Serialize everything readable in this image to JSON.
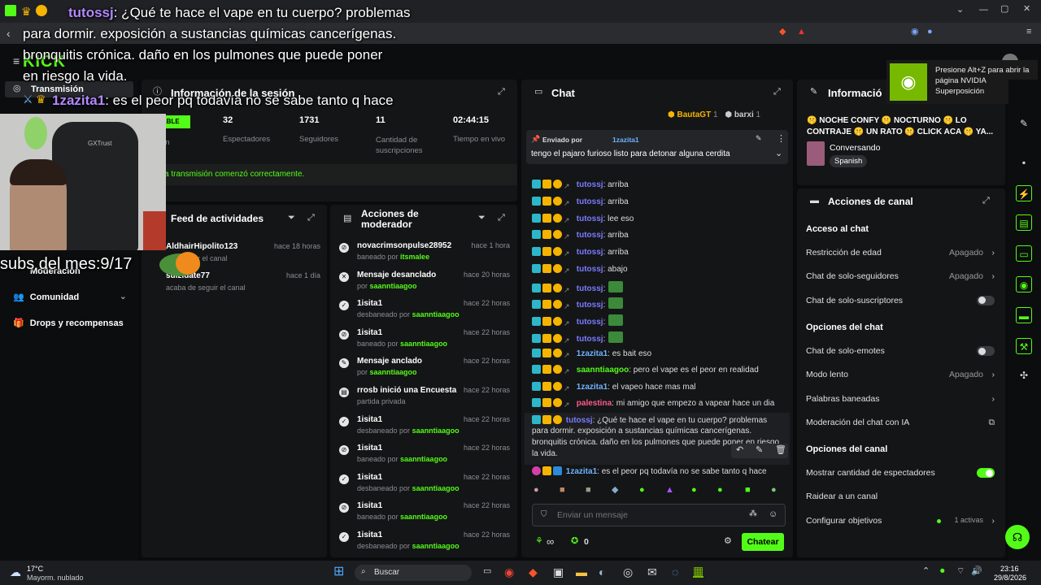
{
  "overlay": {
    "title_user": "tutossj",
    "title_line1": ": ¿Qué te hace el vape en tu cuerpo? problemas",
    "title_line2": "para dormir. exposición a sustancias químicas cancerígenas.",
    "title_line3": "bronquitis crónica. daño en los pulmones que puede poner",
    "title_line4": "en riesgo la vida.",
    "second_user": "1zazita1",
    "second_msg": ": es el peor pq todavía no se sabe tanto q hace",
    "subs_text": "subs del mes:9/17",
    "webcam_brand": "GXTrust"
  },
  "browser": {
    "tab_label": "Transmisión"
  },
  "nvidia": {
    "text": "Presione Alt+Z para abrir la página NVIDIA Superposición"
  },
  "session": {
    "title": "Información de la sesión",
    "badge": "UDABLE",
    "badge_sub": "ón",
    "stats": [
      {
        "value": "32",
        "label": "Espectadores"
      },
      {
        "value": "1731",
        "label": "Seguidores"
      },
      {
        "value": "11",
        "label": "Cantidad de suscripciones"
      },
      {
        "value": "02:44:15",
        "label": "Tiempo en vivo"
      }
    ],
    "status": "a transmisión comenzó correctamente."
  },
  "sidebar": {
    "items": [
      {
        "label": "Moderación"
      },
      {
        "label": "Comunidad"
      },
      {
        "label": "Drops y recompensas"
      }
    ]
  },
  "feed": {
    "title": "Feed de actividades",
    "items": [
      {
        "user": "AldhairHipolito123",
        "action": "eguir el canal",
        "time": "hace 18 horas"
      },
      {
        "user": "suizidate77",
        "action": "acaba de seguir el canal",
        "time": "hace 1 día"
      }
    ]
  },
  "modactions": {
    "title_line1": "Acciones de",
    "title_line2": "moderador",
    "items": [
      {
        "t": "novacrimsonpulse28952",
        "pre": "baneado por ",
        "by": "itsmalee",
        "time": "hace 1 hora",
        "icon": "⊘"
      },
      {
        "t": "Mensaje desanclado",
        "pre": "por ",
        "by": "saanntiaagoo",
        "time": "hace 20 horas",
        "icon": "✕"
      },
      {
        "t": "1isita1",
        "pre": "desbaneado por ",
        "by": "saanntiaagoo",
        "time": "hace 22 horas",
        "icon": "✓"
      },
      {
        "t": "1isita1",
        "pre": "baneado por ",
        "by": "saanntiaagoo",
        "time": "hace 22 horas",
        "icon": "⊘"
      },
      {
        "t": "Mensaje anclado",
        "pre": "por ",
        "by": "saanntiaagoo",
        "time": "hace 22 horas",
        "icon": "✎"
      },
      {
        "t": "rrosb inició una Encuesta",
        "pre": "partida privada",
        "by": "",
        "time": "hace 22 horas",
        "icon": "▤"
      },
      {
        "t": "1isita1",
        "pre": "desbaneado por ",
        "by": "saanntiaagoo",
        "time": "hace 22 horas",
        "icon": "✓"
      },
      {
        "t": "1isita1",
        "pre": "baneado por ",
        "by": "saanntiaagoo",
        "time": "hace 22 horas",
        "icon": "⊘"
      },
      {
        "t": "1isita1",
        "pre": "desbaneado por ",
        "by": "saanntiaagoo",
        "time": "hace 22 horas",
        "icon": "✓"
      },
      {
        "t": "1isita1",
        "pre": "baneado por ",
        "by": "saanntiaagoo",
        "time": "hace 22 horas",
        "icon": "⊘"
      },
      {
        "t": "1isita1",
        "pre": "desbaneado por ",
        "by": "saanntiaagoo",
        "time": "hace 22 horas",
        "icon": "✓"
      }
    ]
  },
  "chat": {
    "title": "Chat",
    "top_users": [
      {
        "name": "BautaGT",
        "count": "1"
      },
      {
        "name": "barxi",
        "count": "1"
      }
    ],
    "pinned_by_label": "Enviado por",
    "pinned_user": "1zazita1",
    "pinned_msg": "tengo el pajaro furioso listo para detonar alguna cerdita",
    "messages": [
      {
        "user": "tutossj",
        "text": ": arriba",
        "color": "#7b7bff"
      },
      {
        "user": "tutossj",
        "text": ": arriba",
        "color": "#7b7bff"
      },
      {
        "user": "tutossj",
        "text": ": lee eso",
        "color": "#7b7bff"
      },
      {
        "user": "tutossj",
        "text": ": arriba",
        "color": "#7b7bff"
      },
      {
        "user": "tutossj",
        "text": ": arriba",
        "color": "#7b7bff"
      },
      {
        "user": "tutossj",
        "text": ": abajo",
        "color": "#7b7bff"
      },
      {
        "user": "tutossj",
        "text": ":",
        "color": "#7b7bff"
      },
      {
        "user": "tutossj",
        "text": ":",
        "color": "#7b7bff"
      },
      {
        "user": "tutossj",
        "text": ":",
        "color": "#7b7bff"
      },
      {
        "user": "tutossj",
        "text": ":",
        "color": "#7b7bff"
      },
      {
        "user": "1zazita1",
        "text": ": es bait eso",
        "color": "#6fb3ff"
      },
      {
        "user": "saanntiaagoo",
        "text": ": pero el vape es el peor en realidad",
        "color": "#53fc18"
      },
      {
        "user": "1zazita1",
        "text": ": el vapeo hace mas mal",
        "color": "#6fb3ff"
      },
      {
        "user": "palestina",
        "text": ": mi amigo que empezo a vapear hace un dia",
        "color": "#ff5c8a"
      }
    ],
    "long_user": "tutossj",
    "long_l1": ": ¿Qué te hace el vape en tu cuerpo? problemas",
    "long_l2": "para dormir. exposición a sustancias químicas cancerígenas.",
    "long_l3": "bronquitis crónica. daño en los pulmones que puede poner en riesgo",
    "long_l4": "la vida.",
    "last_user": "1zazita1",
    "last_msg": ": es el peor pq todavía no se sabe tanto q hace",
    "input_placeholder": "Enviar un mensaje",
    "points": "∞",
    "kicks": "0",
    "send_label": "Chatear"
  },
  "info": {
    "title": "Informació",
    "stream_title": "🤫 NOCHE CONFY 🤫 NOCTURNO 🤫 LO CONTRAJE 🤫 UN RATO 🤫 CLICK ACA 🤫 YA...",
    "category": "Conversando",
    "language": "Spanish"
  },
  "channel_actions": {
    "title": "Acciones de canal",
    "sections": [
      {
        "title": "Acceso al chat",
        "rows": [
          {
            "label": "Restricción de edad",
            "value": "Apagado",
            "type": "chevron"
          },
          {
            "label": "Chat de solo-seguidores",
            "value": "Apagado",
            "type": "chevron"
          },
          {
            "label": "Chat de solo-suscriptores",
            "value": "",
            "type": "toggle-off"
          }
        ]
      },
      {
        "title": "Opciones del chat",
        "rows": [
          {
            "label": "Chat de solo-emotes",
            "value": "",
            "type": "toggle-off"
          },
          {
            "label": "Modo lento",
            "value": "Apagado",
            "type": "chevron"
          },
          {
            "label": "Palabras baneadas",
            "value": "",
            "type": "chevron"
          },
          {
            "label": "Moderación del chat con IA",
            "value": "",
            "type": "external"
          }
        ]
      },
      {
        "title": "Opciones del canal",
        "rows": [
          {
            "label": "Mostrar cantidad de espectadores",
            "value": "",
            "type": "toggle-on"
          },
          {
            "label": "Raidear a un canal",
            "value": "",
            "type": "none"
          },
          {
            "label": "Configurar objetivos",
            "value": "1 activas",
            "type": "chevron"
          }
        ]
      }
    ]
  },
  "taskbar": {
    "weather_temp": "17°C",
    "weather_desc": "Mayorm. nublado",
    "search": "Buscar",
    "time": "23:16",
    "date": "29/8/2026"
  },
  "colors": {
    "accent": "#53fc18",
    "bg": "#0a0b0c",
    "panel": "#141517"
  }
}
